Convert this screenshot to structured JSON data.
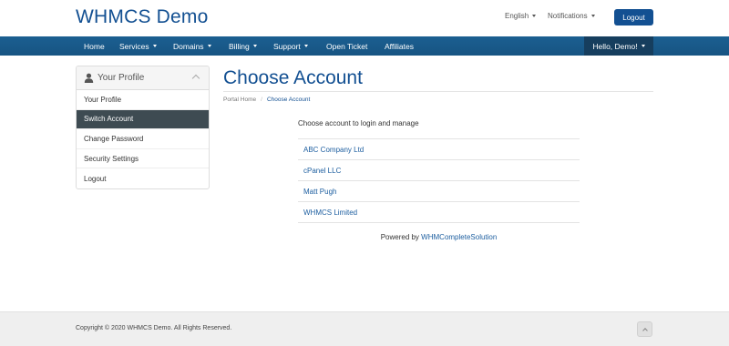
{
  "header": {
    "logo": "WHMCS Demo",
    "language": "English",
    "notifications": "Notifications",
    "logout": "Logout"
  },
  "nav": {
    "items": [
      {
        "label": "Home"
      },
      {
        "label": "Services"
      },
      {
        "label": "Domains"
      },
      {
        "label": "Billing"
      },
      {
        "label": "Support"
      },
      {
        "label": "Open Ticket"
      },
      {
        "label": "Affiliates"
      }
    ],
    "user": "Hello, Demo!"
  },
  "sidebar": {
    "title": "Your Profile",
    "items": [
      {
        "label": "Your Profile"
      },
      {
        "label": "Switch Account"
      },
      {
        "label": "Change Password"
      },
      {
        "label": "Security Settings"
      },
      {
        "label": "Logout"
      }
    ]
  },
  "main": {
    "title": "Choose Account",
    "breadcrumb": {
      "home": "Portal Home",
      "current": "Choose Account"
    },
    "intro": "Choose account to login and manage",
    "accounts": [
      {
        "name": "ABC Company Ltd"
      },
      {
        "name": "cPanel LLC"
      },
      {
        "name": "Matt Pugh"
      },
      {
        "name": "WHMCS Limited"
      }
    ],
    "powered_prefix": "Powered by",
    "powered_link": "WHMCompleteSolution"
  },
  "footer": {
    "copyright": "Copyright © 2020 WHMCS Demo. All Rights Reserved."
  },
  "colors": {
    "brand": "#135092",
    "navbar": "#1b5f91",
    "nav_user_bg": "#163e5e",
    "sidebar_active": "#3e4b52",
    "link": "#1e5fa0"
  },
  "icons": {
    "sidebar_head": "user-icon",
    "collapse": "chevron-up-icon",
    "back_to_top": "chevron-up-icon"
  }
}
